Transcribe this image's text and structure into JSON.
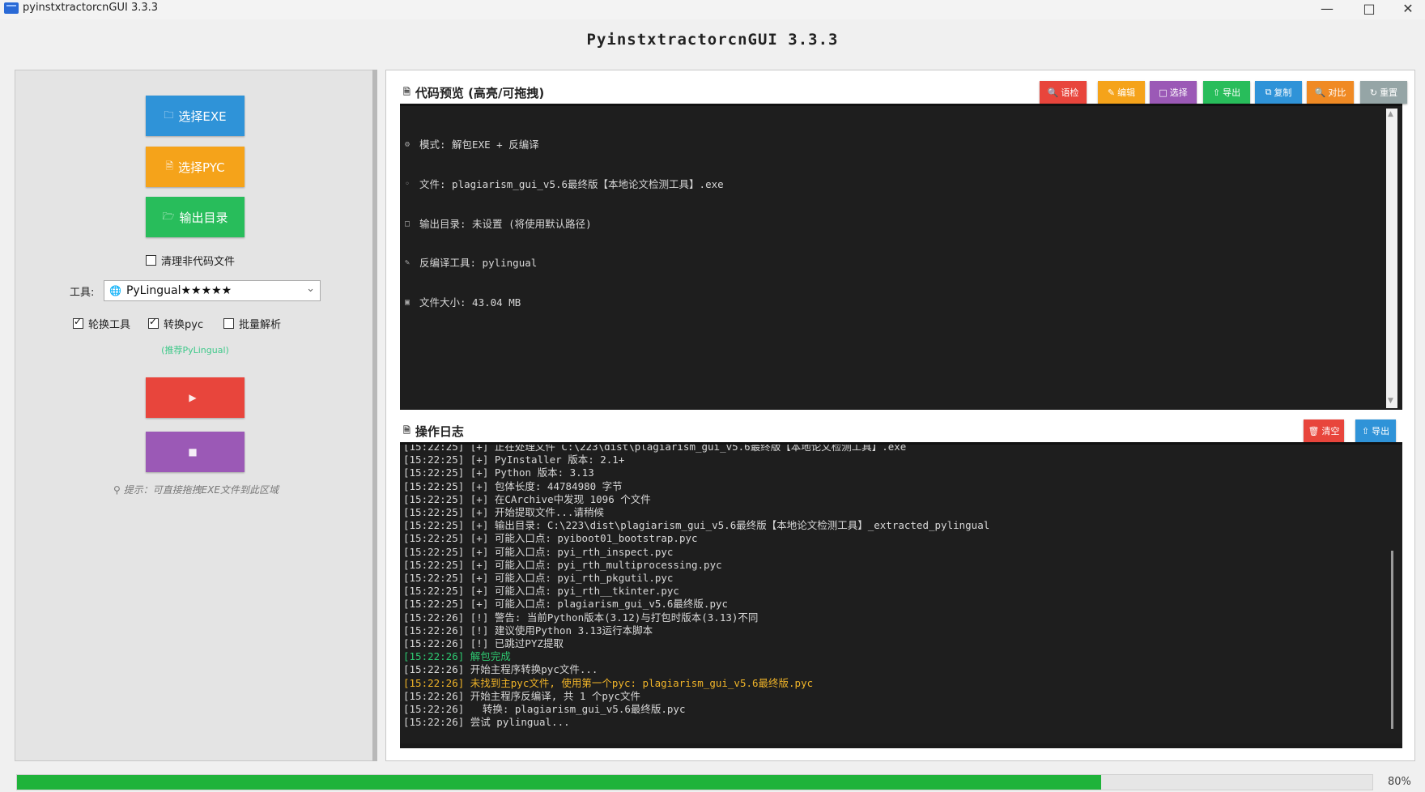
{
  "window": {
    "title": "pyinstxtractorcnGUI 3.3.3",
    "minimize_icon": "minimize-icon",
    "maximize_icon": "maximize-icon",
    "close_icon": "close-icon"
  },
  "app": {
    "heading": "PyinstxtractorcnGUI 3.3.3"
  },
  "left": {
    "btn_exe": "选择EXE",
    "btn_pyc": "选择PYC",
    "btn_output": "输出目录",
    "clean_label": "清理非代码文件",
    "clean_checked": false,
    "tool_label": "工具:",
    "tool_value": "PyLingual★★★★★",
    "opt_rotate": "轮换工具",
    "opt_rotate_checked": true,
    "opt_convert": "转换pyc",
    "opt_convert_checked": true,
    "opt_batch": "批量解析",
    "opt_batch_checked": false,
    "hint": "(推荐PyLingual)",
    "btn_start": "",
    "btn_stop": "",
    "tip": "提示：可直接拖拽EXE文件到此区域"
  },
  "preview": {
    "title": "代码预览 (高亮/可拖拽)",
    "tools": [
      "语检",
      "编辑",
      "选择",
      "导出",
      "复制",
      "对比",
      "重置"
    ],
    "lines": [
      "模式: 解包EXE + 反编译",
      "文件: plagiarism_gui_v5.6最终版【本地论文检测工具】.exe",
      "输出目录: 未设置 (将使用默认路径)",
      "反编译工具: pylingual",
      "文件大小: 43.04 MB"
    ]
  },
  "log": {
    "title": "操作日志",
    "clear": "清空",
    "export": "导出",
    "lines": [
      {
        "t": "[15:22:25] [+] 正在处理文件 C:\\223\\dist\\plagiarism_gui_v5.6最终版【本地论文检测工具】.exe",
        "c": ""
      },
      {
        "t": "[15:22:25] [+] PyInstaller 版本: 2.1+",
        "c": ""
      },
      {
        "t": "[15:22:25] [+] Python 版本: 3.13",
        "c": ""
      },
      {
        "t": "[15:22:25] [+] 包体长度: 44784980 字节",
        "c": ""
      },
      {
        "t": "[15:22:25] [+] 在CArchive中发现 1096 个文件",
        "c": ""
      },
      {
        "t": "[15:22:25] [+] 开始提取文件...请稍候",
        "c": ""
      },
      {
        "t": "[15:22:25] [+] 输出目录: C:\\223\\dist\\plagiarism_gui_v5.6最终版【本地论文检测工具】_extracted_pylingual",
        "c": ""
      },
      {
        "t": "[15:22:25] [+] 可能入口点: pyiboot01_bootstrap.pyc",
        "c": ""
      },
      {
        "t": "[15:22:25] [+] 可能入口点: pyi_rth_inspect.pyc",
        "c": ""
      },
      {
        "t": "[15:22:25] [+] 可能入口点: pyi_rth_multiprocessing.pyc",
        "c": ""
      },
      {
        "t": "[15:22:25] [+] 可能入口点: pyi_rth_pkgutil.pyc",
        "c": ""
      },
      {
        "t": "[15:22:25] [+] 可能入口点: pyi_rth__tkinter.pyc",
        "c": ""
      },
      {
        "t": "[15:22:25] [+] 可能入口点: plagiarism_gui_v5.6最终版.pyc",
        "c": ""
      },
      {
        "t": "[15:22:26] [!] 警告: 当前Python版本(3.12)与打包时版本(3.13)不同",
        "c": ""
      },
      {
        "t": "[15:22:26] [!] 建议使用Python 3.13运行本脚本",
        "c": ""
      },
      {
        "t": "[15:22:26] [!] 已跳过PYZ提取",
        "c": ""
      },
      {
        "t": "[15:22:26] 解包完成",
        "c": "g"
      },
      {
        "t": "[15:22:26] 开始主程序转换pyc文件...",
        "c": ""
      },
      {
        "t": "[15:22:26] 未找到主pyc文件, 使用第一个pyc: plagiarism_gui_v5.6最终版.pyc",
        "c": "y"
      },
      {
        "t": "[15:22:26] 开始主程序反编译, 共 1 个pyc文件",
        "c": ""
      },
      {
        "t": "[15:22:26]   转换: plagiarism_gui_v5.6最终版.pyc",
        "c": ""
      },
      {
        "t": "[15:22:26] 尝试 pylingual...",
        "c": ""
      }
    ]
  },
  "progress": {
    "value": 80,
    "label": "80%"
  },
  "colors": {
    "exe": "#2f93d8",
    "pyc": "#f5a31a",
    "output": "#28bd5b",
    "start": "#e8453c",
    "stop": "#9b59b6",
    "tool_red": "#e8453c",
    "tool_orange": "#f5a31a",
    "tool_purple": "#9b59b6",
    "tool_green": "#28bd5b",
    "tool_blue": "#2f93d8",
    "tool_orange2": "#f08a24",
    "tool_gray": "#95a5a6"
  }
}
